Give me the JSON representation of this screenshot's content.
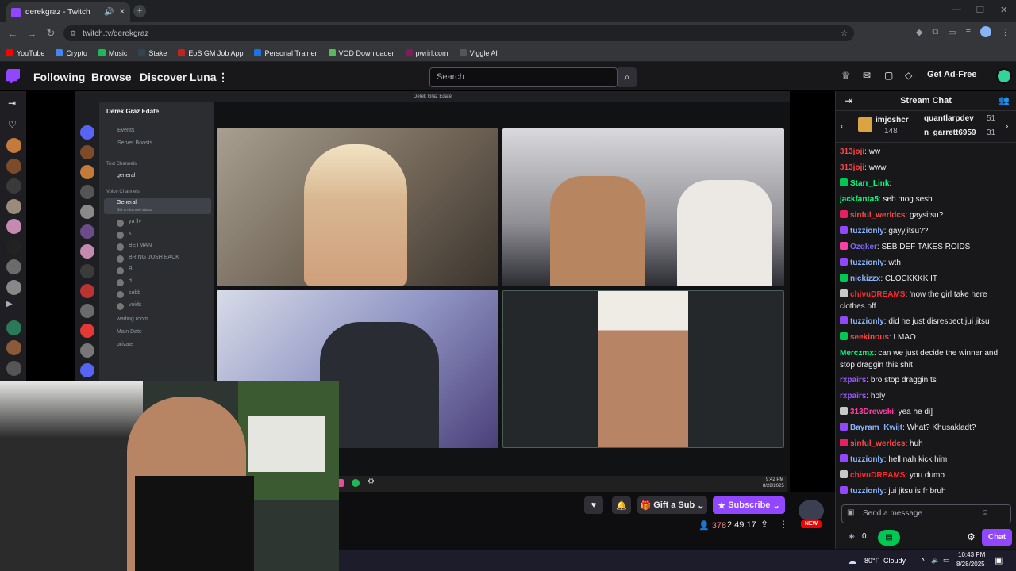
{
  "browser": {
    "tab_title": "derekgraz - Twitch",
    "url": "twitch.tv/derekgraz",
    "bookmarks": [
      {
        "label": "YouTube",
        "color": "#ff0000"
      },
      {
        "label": "Crypto",
        "color": "#4285f4"
      },
      {
        "label": "Music",
        "color": "#1db954"
      },
      {
        "label": "Stake",
        "color": "#2f4553"
      },
      {
        "label": "EoS GM Job App",
        "color": "#c5221f"
      },
      {
        "label": "Personal Trainer",
        "color": "#1a73e8"
      },
      {
        "label": "VOD Downloader",
        "color": "#5cb85c"
      },
      {
        "label": "pwrirl.com",
        "color": "#7a1f5c"
      },
      {
        "label": "Viggle AI",
        "color": "#555555"
      }
    ]
  },
  "twitch": {
    "nav": {
      "following": "Following",
      "browse": "Browse",
      "discover": "Discover Luna"
    },
    "search_placeholder": "Search",
    "ad_free": "Get Ad-Free",
    "stream": {
      "gift_sub": "Gift a Sub",
      "subscribe": "Subscribe",
      "viewers": "378",
      "uptime": "2:49:17",
      "new_badge": "NEW"
    }
  },
  "discord": {
    "window_title": "Derek Graz Edate",
    "server_name": "Derek Graz Edate",
    "top_items": [
      "Events",
      "Server Boosts"
    ],
    "text_channels_header": "Text Channels",
    "text_channels": [
      "general"
    ],
    "voice_channels_header": "Voice Channels",
    "voice_channel": "General",
    "voice_status": "Set a channel status",
    "voice_users": [
      "ya llv",
      "k",
      "BETMAN",
      "BRING JOSH BACK",
      "B",
      "d",
      "sebb",
      "voids"
    ],
    "other_channels": [
      "waiting room",
      "Main Date",
      "private"
    ],
    "taskbar_time": "9:42 PM",
    "taskbar_date": "8/28/2025"
  },
  "chat": {
    "title": "Stream Chat",
    "gifters": [
      {
        "name": "imjoshcr",
        "count": "148"
      },
      {
        "name": "quantlarpdev",
        "count": "51"
      },
      {
        "name": "n_garrett6959",
        "count": "31"
      }
    ],
    "messages": [
      {
        "user": "313joji",
        "color": "#ff4545",
        "text": ": ww",
        "badge": ""
      },
      {
        "user": "313joji",
        "color": "#ff4545",
        "text": ": www",
        "badge": ""
      },
      {
        "user": "Starr_Link",
        "color": "#00ff7f",
        "text": ":",
        "badge": "#00c853"
      },
      {
        "user": "jackfanta5",
        "color": "#00ff7f",
        "text": ": seb mog sesh",
        "badge": ""
      },
      {
        "user": "sinful_werldcs",
        "color": "#ff4545",
        "text": ": gaysitsu?",
        "badge": "#e91e63"
      },
      {
        "user": "tuzzionly",
        "color": "#8ab4f8",
        "text": ": gayyjitsu??",
        "badge": "#9146ff"
      },
      {
        "user": "Ozqker",
        "color": "#7b68ee",
        "text": ": SEB DEF TAKES ROIDS",
        "badge": "#ff3ea5"
      },
      {
        "user": "tuzzionly",
        "color": "#8ab4f8",
        "text": ": wth",
        "badge": "#9146ff"
      },
      {
        "user": "nickizzx",
        "color": "#8ab4f8",
        "text": ": CLOCKKKK IT",
        "badge": "#00c853"
      },
      {
        "user": "chivuDREAMS",
        "color": "#ff2a2a",
        "text": ": 'now the girl take here clothes off",
        "badge": "#c8c8c8"
      },
      {
        "user": "tuzzionly",
        "color": "#8ab4f8",
        "text": ": did he just disrespect jui jitsu",
        "badge": "#9146ff"
      },
      {
        "user": "seekinous",
        "color": "#ff4545",
        "text": ": LMAO",
        "badge": "#00c853"
      },
      {
        "user": "Merczmx",
        "color": "#00ff7f",
        "text": ": can we just decide the winner and stop draggin this shit",
        "badge": ""
      },
      {
        "user": "rxpairs",
        "color": "#9b59ff",
        "text": ": bro stop draggin ts",
        "badge": ""
      },
      {
        "user": "rxpairs",
        "color": "#9b59ff",
        "text": ": holy",
        "badge": ""
      },
      {
        "user": "313Drewski",
        "color": "#ff3ea5",
        "text": ": yea he di]",
        "badge": "#c8c8c8"
      },
      {
        "user": "Bayram_Kwijt",
        "color": "#8ab4f8",
        "text": ": What? Khusakladt?",
        "badge": "#9146ff"
      },
      {
        "user": "sinful_werldcs",
        "color": "#ff4545",
        "text": ": huh",
        "badge": "#e91e63"
      },
      {
        "user": "tuzzionly",
        "color": "#8ab4f8",
        "text": ": hell nah kick him",
        "badge": "#9146ff"
      },
      {
        "user": "chivuDREAMS",
        "color": "#ff2a2a",
        "text": ": you dumb",
        "badge": "#c8c8c8"
      },
      {
        "user": "tuzzionly",
        "color": "#8ab4f8",
        "text": ": jui jitsu is fr bruh",
        "badge": "#9146ff"
      }
    ],
    "input_placeholder": "Send a message",
    "points": "0",
    "chat_button": "Chat"
  },
  "windows": {
    "weather_temp": "80°F",
    "weather_cond": "Cloudy",
    "time": "10:43 PM",
    "date": "8/28/2025"
  }
}
